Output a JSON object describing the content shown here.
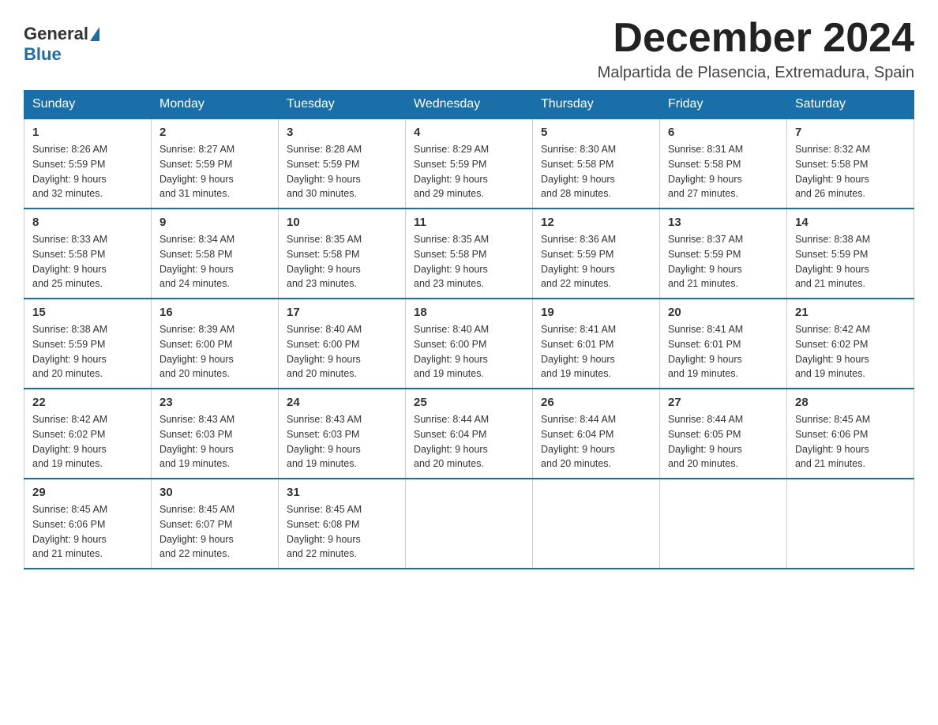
{
  "logo": {
    "general": "General",
    "blue": "Blue",
    "subtitle": "Blue"
  },
  "header": {
    "month_title": "December 2024",
    "location": "Malpartida de Plasencia, Extremadura, Spain"
  },
  "weekdays": [
    "Sunday",
    "Monday",
    "Tuesday",
    "Wednesday",
    "Thursday",
    "Friday",
    "Saturday"
  ],
  "weeks": [
    [
      {
        "day": "1",
        "sunrise": "8:26 AM",
        "sunset": "5:59 PM",
        "daylight": "9 hours and 32 minutes."
      },
      {
        "day": "2",
        "sunrise": "8:27 AM",
        "sunset": "5:59 PM",
        "daylight": "9 hours and 31 minutes."
      },
      {
        "day": "3",
        "sunrise": "8:28 AM",
        "sunset": "5:59 PM",
        "daylight": "9 hours and 30 minutes."
      },
      {
        "day": "4",
        "sunrise": "8:29 AM",
        "sunset": "5:59 PM",
        "daylight": "9 hours and 29 minutes."
      },
      {
        "day": "5",
        "sunrise": "8:30 AM",
        "sunset": "5:58 PM",
        "daylight": "9 hours and 28 minutes."
      },
      {
        "day": "6",
        "sunrise": "8:31 AM",
        "sunset": "5:58 PM",
        "daylight": "9 hours and 27 minutes."
      },
      {
        "day": "7",
        "sunrise": "8:32 AM",
        "sunset": "5:58 PM",
        "daylight": "9 hours and 26 minutes."
      }
    ],
    [
      {
        "day": "8",
        "sunrise": "8:33 AM",
        "sunset": "5:58 PM",
        "daylight": "9 hours and 25 minutes."
      },
      {
        "day": "9",
        "sunrise": "8:34 AM",
        "sunset": "5:58 PM",
        "daylight": "9 hours and 24 minutes."
      },
      {
        "day": "10",
        "sunrise": "8:35 AM",
        "sunset": "5:58 PM",
        "daylight": "9 hours and 23 minutes."
      },
      {
        "day": "11",
        "sunrise": "8:35 AM",
        "sunset": "5:58 PM",
        "daylight": "9 hours and 23 minutes."
      },
      {
        "day": "12",
        "sunrise": "8:36 AM",
        "sunset": "5:59 PM",
        "daylight": "9 hours and 22 minutes."
      },
      {
        "day": "13",
        "sunrise": "8:37 AM",
        "sunset": "5:59 PM",
        "daylight": "9 hours and 21 minutes."
      },
      {
        "day": "14",
        "sunrise": "8:38 AM",
        "sunset": "5:59 PM",
        "daylight": "9 hours and 21 minutes."
      }
    ],
    [
      {
        "day": "15",
        "sunrise": "8:38 AM",
        "sunset": "5:59 PM",
        "daylight": "9 hours and 20 minutes."
      },
      {
        "day": "16",
        "sunrise": "8:39 AM",
        "sunset": "6:00 PM",
        "daylight": "9 hours and 20 minutes."
      },
      {
        "day": "17",
        "sunrise": "8:40 AM",
        "sunset": "6:00 PM",
        "daylight": "9 hours and 20 minutes."
      },
      {
        "day": "18",
        "sunrise": "8:40 AM",
        "sunset": "6:00 PM",
        "daylight": "9 hours and 19 minutes."
      },
      {
        "day": "19",
        "sunrise": "8:41 AM",
        "sunset": "6:01 PM",
        "daylight": "9 hours and 19 minutes."
      },
      {
        "day": "20",
        "sunrise": "8:41 AM",
        "sunset": "6:01 PM",
        "daylight": "9 hours and 19 minutes."
      },
      {
        "day": "21",
        "sunrise": "8:42 AM",
        "sunset": "6:02 PM",
        "daylight": "9 hours and 19 minutes."
      }
    ],
    [
      {
        "day": "22",
        "sunrise": "8:42 AM",
        "sunset": "6:02 PM",
        "daylight": "9 hours and 19 minutes."
      },
      {
        "day": "23",
        "sunrise": "8:43 AM",
        "sunset": "6:03 PM",
        "daylight": "9 hours and 19 minutes."
      },
      {
        "day": "24",
        "sunrise": "8:43 AM",
        "sunset": "6:03 PM",
        "daylight": "9 hours and 19 minutes."
      },
      {
        "day": "25",
        "sunrise": "8:44 AM",
        "sunset": "6:04 PM",
        "daylight": "9 hours and 20 minutes."
      },
      {
        "day": "26",
        "sunrise": "8:44 AM",
        "sunset": "6:04 PM",
        "daylight": "9 hours and 20 minutes."
      },
      {
        "day": "27",
        "sunrise": "8:44 AM",
        "sunset": "6:05 PM",
        "daylight": "9 hours and 20 minutes."
      },
      {
        "day": "28",
        "sunrise": "8:45 AM",
        "sunset": "6:06 PM",
        "daylight": "9 hours and 21 minutes."
      }
    ],
    [
      {
        "day": "29",
        "sunrise": "8:45 AM",
        "sunset": "6:06 PM",
        "daylight": "9 hours and 21 minutes."
      },
      {
        "day": "30",
        "sunrise": "8:45 AM",
        "sunset": "6:07 PM",
        "daylight": "9 hours and 22 minutes."
      },
      {
        "day": "31",
        "sunrise": "8:45 AM",
        "sunset": "6:08 PM",
        "daylight": "9 hours and 22 minutes."
      },
      null,
      null,
      null,
      null
    ]
  ],
  "labels": {
    "sunrise": "Sunrise:",
    "sunset": "Sunset:",
    "daylight": "Daylight:"
  }
}
